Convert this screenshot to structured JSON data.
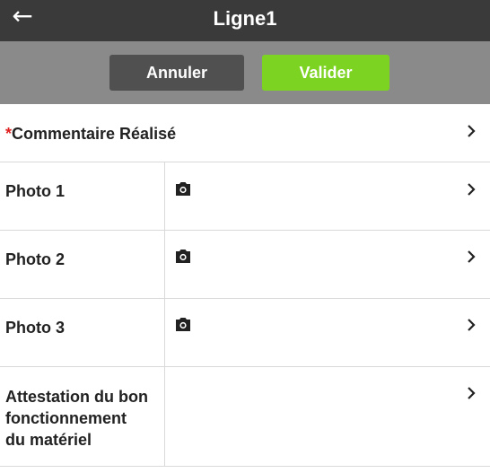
{
  "header": {
    "title": "Ligne1",
    "back_icon": "arrow-left-icon"
  },
  "actions": {
    "cancel_label": "Annuler",
    "validate_label": "Valider",
    "validate_color": "#7dd321",
    "cancel_color": "#505050"
  },
  "form": {
    "comment": {
      "required_mark": "*",
      "label": "Commentaire Réalisé"
    },
    "photos": [
      {
        "label": "Photo 1",
        "icon": "camera-icon"
      },
      {
        "label": "Photo 2",
        "icon": "camera-icon"
      },
      {
        "label": "Photo 3",
        "icon": "camera-icon"
      }
    ],
    "attestation": {
      "label_line1": "Attestation du bon",
      "label_line2": "fonctionnement",
      "label_line3": "du matériel"
    }
  },
  "colors": {
    "header_bg": "#3a3a3a",
    "action_bar_bg": "#8a8a8a",
    "required": "#e02020"
  }
}
